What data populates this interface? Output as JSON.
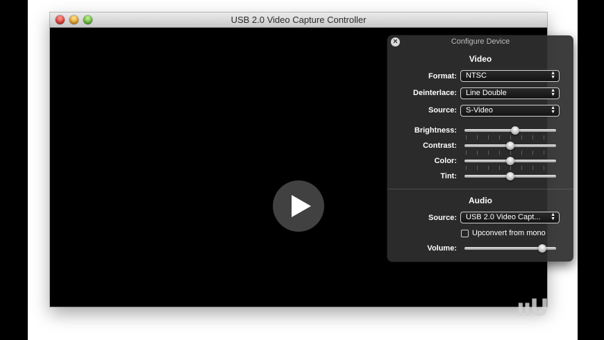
{
  "window": {
    "title": "USB 2.0 Video Capture Controller"
  },
  "hud": {
    "title": "Configure Device",
    "close_glyph": "×",
    "video": {
      "section_title": "Video",
      "format": {
        "label": "Format:",
        "value": "NTSC"
      },
      "deinterlace": {
        "label": "Deinterlace:",
        "value": "Line Double"
      },
      "source": {
        "label": "Source:",
        "value": "S-Video"
      },
      "brightness": {
        "label": "Brightness:",
        "level": 0.55
      },
      "contrast": {
        "label": "Contrast:",
        "level": 0.5
      },
      "color": {
        "label": "Color:",
        "level": 0.5
      },
      "tint": {
        "label": "Tint:",
        "level": 0.5
      }
    },
    "audio": {
      "section_title": "Audio",
      "source": {
        "label": "Source:",
        "value": "USB 2.0 Video Capt..."
      },
      "upconvert": {
        "label": "Upconvert from mono",
        "checked": false
      },
      "volume": {
        "label": "Volume:",
        "level": 0.85
      }
    }
  },
  "watermark": {
    "text": "ııU"
  },
  "icons": {
    "play": "play-icon",
    "arrows": "popup-arrows-icon",
    "close": "close-icon"
  }
}
